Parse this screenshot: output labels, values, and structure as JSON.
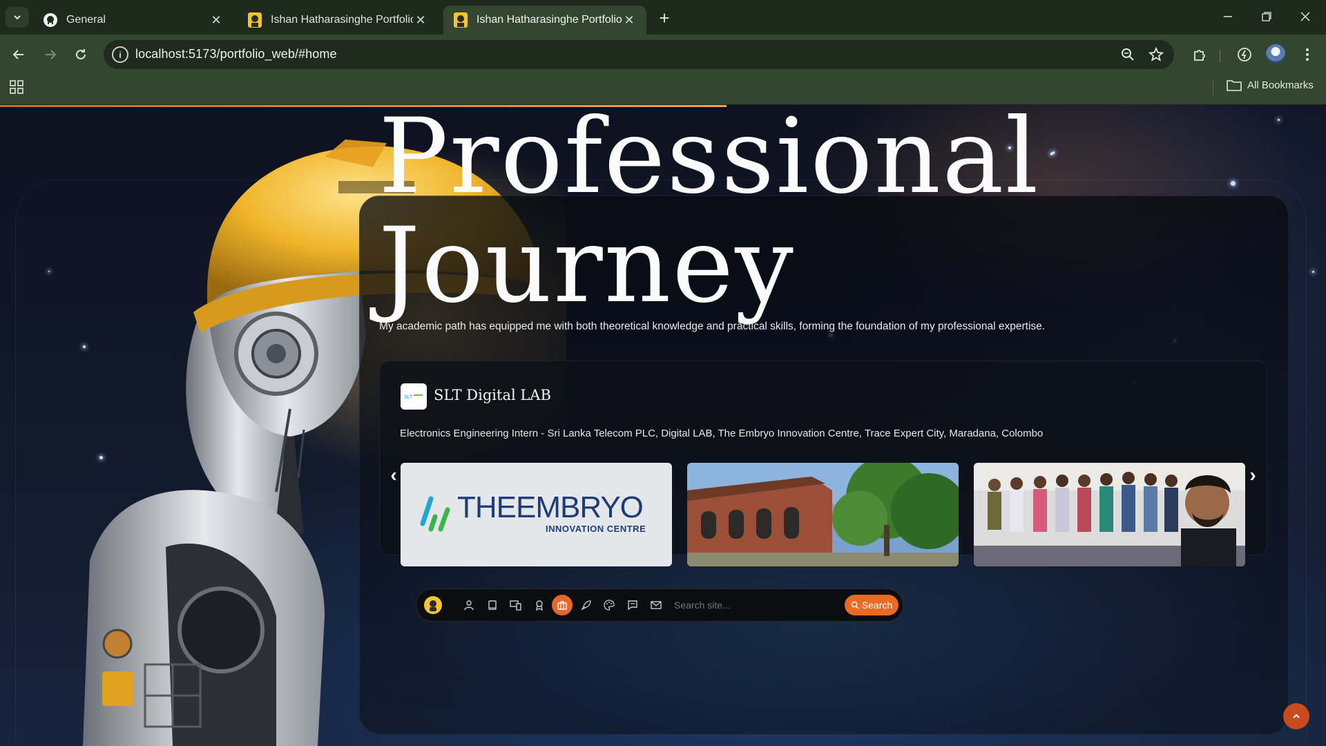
{
  "browser": {
    "tabs": [
      {
        "title": "General",
        "icon": "github-icon",
        "active": false
      },
      {
        "title": "Ishan Hatharasinghe Portfolio",
        "icon": "portfolio-favicon",
        "active": false
      },
      {
        "title": "Ishan Hatharasinghe Portfolio",
        "icon": "portfolio-favicon",
        "active": true
      }
    ],
    "url": "localhost:5173/portfolio_web/#home",
    "bookmarks_label": "All Bookmarks"
  },
  "hero": {
    "title_line1": "Professional",
    "title_line2": "Journey",
    "subtitle": "My academic path has equipped me with both theoretical knowledge and practical skills, forming the foundation of my professional expertise."
  },
  "experience": {
    "company": "SLT Digital LAB",
    "description": "Electronics Engineering Intern - Sri Lanka Telecom PLC, Digital LAB, The Embryo Innovation Centre, Trace Expert City, Maradana, Colombo",
    "slides": [
      {
        "type": "logo",
        "brand_main": "THEEMBRYO",
        "brand_sub": "INNOVATION CENTRE"
      },
      {
        "type": "photo",
        "subject": "brick-building"
      },
      {
        "type": "photo",
        "subject": "team-group"
      }
    ]
  },
  "dock": {
    "search_placeholder": "Search site...",
    "search_button": "Search",
    "icons": [
      "person-icon",
      "book-icon",
      "devices-icon",
      "award-icon",
      "briefcase-icon",
      "rocket-icon",
      "palette-icon",
      "chat-icon",
      "mail-icon"
    ],
    "active_icon": "briefcase-icon"
  },
  "colors": {
    "accent": "#ea6a22",
    "chrome": "#33462f",
    "tabbar": "#1e2a1c"
  }
}
